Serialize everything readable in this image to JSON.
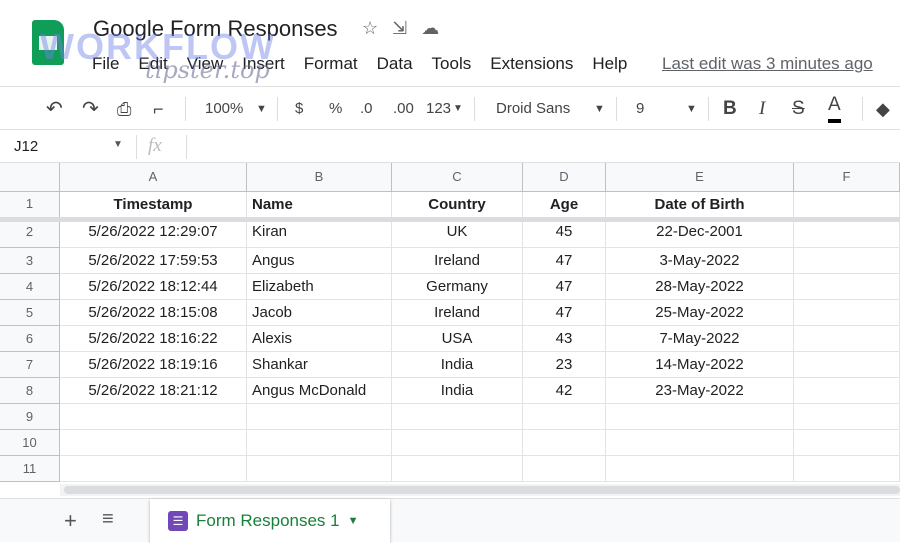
{
  "app": {
    "title": "Google Form Responses",
    "last_edit": "Last edit was 3 minutes ago",
    "watermark": "WORKFLOW tipster.top"
  },
  "menu": [
    "File",
    "Edit",
    "View",
    "Insert",
    "Format",
    "Data",
    "Tools",
    "Extensions",
    "Help"
  ],
  "toolbar": {
    "zoom": "100%",
    "currency": "$",
    "percent": "%",
    "dec_less": ".0",
    "dec_more": ".00",
    "format": "123",
    "font": "Droid Sans",
    "size": "9",
    "bold": "B",
    "italic": "I",
    "strike": "S",
    "textcolor": "A"
  },
  "formula_bar": {
    "cell_ref": "J12",
    "fx": "fx",
    "value": ""
  },
  "columns": [
    "A",
    "B",
    "C",
    "D",
    "E",
    "F"
  ],
  "rows": [
    "1",
    "2",
    "3",
    "4",
    "5",
    "6",
    "7",
    "8",
    "9",
    "10",
    "11"
  ],
  "table": {
    "headers": [
      "Timestamp",
      "Name",
      "Country",
      "Age",
      "Date of Birth"
    ],
    "data": [
      [
        "5/26/2022 12:29:07",
        "Kiran",
        "UK",
        "45",
        "22-Dec-2001"
      ],
      [
        "5/26/2022 17:59:53",
        "Angus",
        "Ireland",
        "47",
        "3-May-2022"
      ],
      [
        "5/26/2022 18:12:44",
        "Elizabeth",
        "Germany",
        "47",
        "28-May-2022"
      ],
      [
        "5/26/2022 18:15:08",
        "Jacob",
        "Ireland",
        "47",
        "25-May-2022"
      ],
      [
        "5/26/2022 18:16:22",
        "Alexis",
        "USA",
        "43",
        "7-May-2022"
      ],
      [
        "5/26/2022 18:19:16",
        "Shankar",
        "India",
        "23",
        "14-May-2022"
      ],
      [
        "5/26/2022 18:21:12",
        "Angus McDonald",
        "India",
        "42",
        "23-May-2022"
      ]
    ]
  },
  "sheet_tabs": {
    "add": "+",
    "list": "≡",
    "active": "Form Responses 1"
  }
}
